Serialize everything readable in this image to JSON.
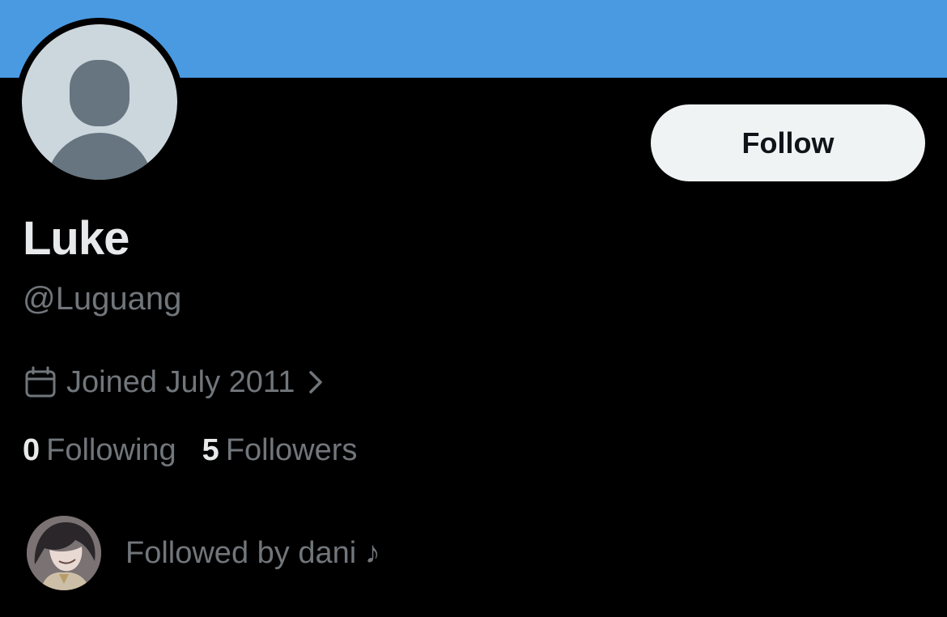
{
  "colors": {
    "banner": "#4a9ae2",
    "background": "#000000",
    "primary_text": "#e7e9ea",
    "secondary_text": "#71767b",
    "button_bg": "#eff3f4",
    "button_text": "#0f1419",
    "avatar_bg": "#ccd6dd",
    "avatar_silhouette": "#66757f"
  },
  "profile": {
    "display_name": "Luke",
    "handle": "@Luguang",
    "joined": "Joined July 2011",
    "avatar_icon": "default-profile-silhouette",
    "calendar_icon": "calendar-icon",
    "chevron_icon": "chevron-right-icon"
  },
  "actions": {
    "follow_label": "Follow"
  },
  "stats": {
    "following_count": "0",
    "following_label": "Following",
    "followers_count": "5",
    "followers_label": "Followers"
  },
  "followed_by": {
    "text": "Followed by dani ♪"
  }
}
